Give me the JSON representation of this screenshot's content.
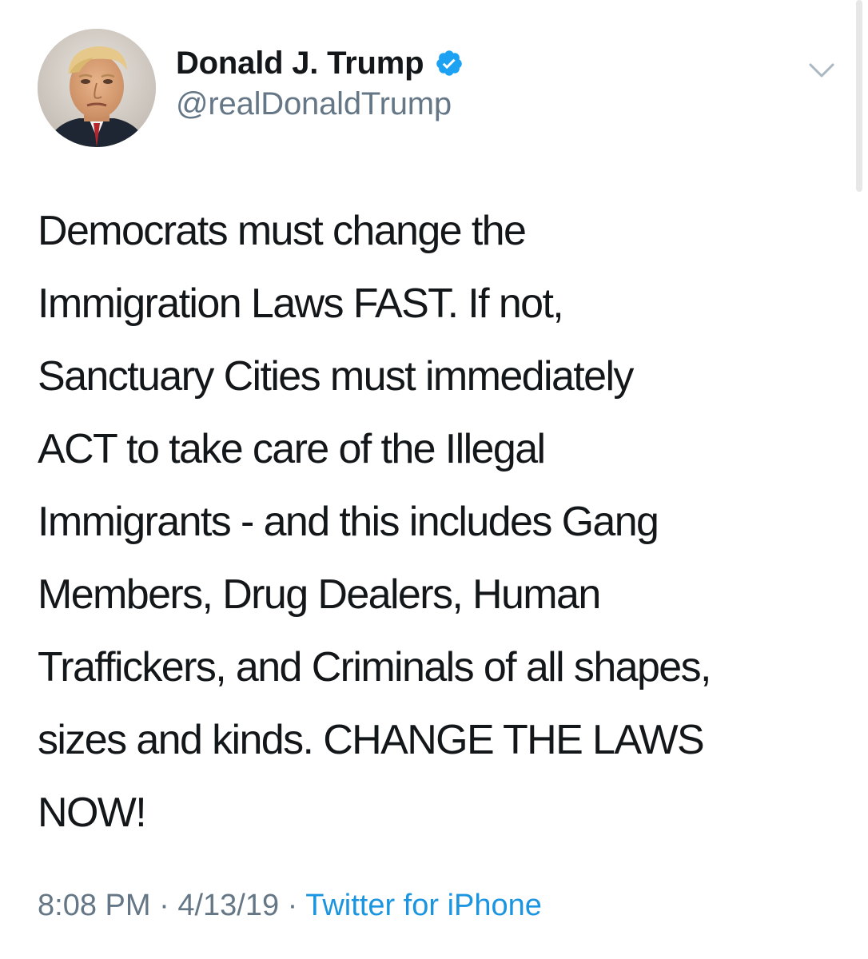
{
  "author": {
    "display_name": "Donald J. Trump",
    "handle": "@realDonaldTrump",
    "verified": true
  },
  "icons": {
    "verified": "verified-badge-icon",
    "menu": "chevron-down-icon"
  },
  "tweet": {
    "lines": [
      "Democrats must change the",
      "Immigration Laws FAST. If not,",
      "Sanctuary Cities must immediately",
      "ACT to take care of the Illegal",
      "Immigrants - and this includes Gang",
      "Members, Drug Dealers, Human",
      "Traffickers, and Criminals of all shapes,",
      "sizes and kinds. CHANGE THE LAWS",
      "NOW!"
    ]
  },
  "meta": {
    "time": "8:08 PM",
    "separator": "·",
    "date": "4/13/19",
    "source": "Twitter for iPhone"
  },
  "colors": {
    "text": "#14171a",
    "secondary": "#657786",
    "link": "#1b95e0",
    "verified": "#1da1f2"
  }
}
